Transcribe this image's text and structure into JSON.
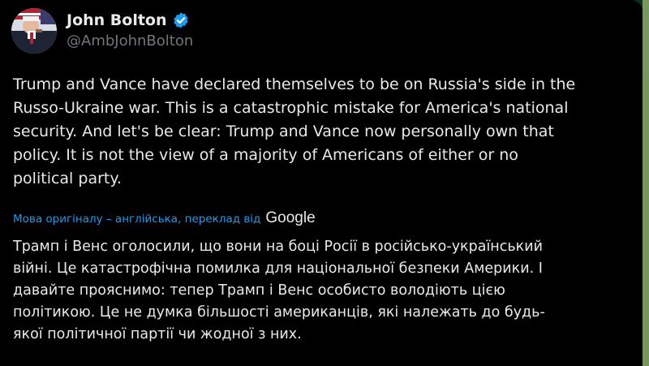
{
  "tweet": {
    "author": {
      "display_name": "John Bolton",
      "handle": "@AmbJohnBolton",
      "verified": true
    },
    "text_lines": [
      "Trump and Vance have declared themselves to be on Russia's side in the",
      "Russo-Ukraine war.  This is a catastrophic mistake for America's national",
      "security.  And let's be clear:  Trump and Vance now personally own that",
      "policy.  It is not the view of a majority of Americans of either or no",
      "political party."
    ],
    "translation_note": {
      "text": "Мова оригіналу – англійська, переклад від",
      "provider": "Google"
    },
    "translated_lines": [
      "Трамп і Венс оголосили, що вони на боці Росії в російсько-український",
      "війні. Це катастрофічна помилка для національної безпеки Америки. І",
      "давайте прояснимо: тепер Трамп і Венс особисто володіють цією",
      "політикою. Це не думка більшості американців, які належать до будь-",
      "якої політичної партії чи жодної з них."
    ]
  },
  "colors": {
    "background": "#000000",
    "text": "#e7e9ea",
    "secondary_text": "#71767b",
    "link": "#1d9bf0",
    "verified_badge": "#1d9bf0"
  },
  "icons": {
    "verified": "verified-badge-icon",
    "avatar": "profile-photo"
  }
}
